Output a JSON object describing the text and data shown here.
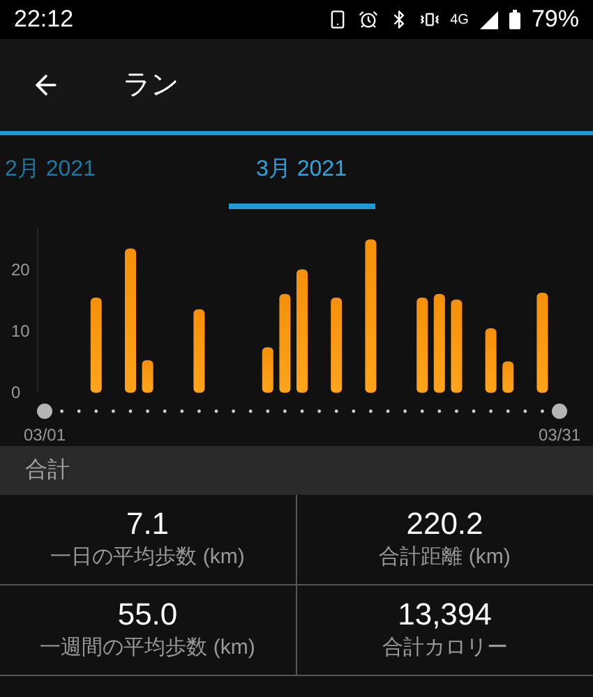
{
  "status_bar": {
    "time": "22:12",
    "network": "4G",
    "battery": "79%"
  },
  "header": {
    "title": "ラン"
  },
  "tabs": [
    {
      "label": "2月 2021",
      "selected": false
    },
    {
      "label": "3月 2021",
      "selected": true
    }
  ],
  "chart_data": {
    "type": "bar",
    "categories": [
      "03/01",
      null,
      null,
      null,
      null,
      null,
      null,
      null,
      null,
      null,
      null,
      null,
      null,
      null,
      null,
      null,
      null,
      null,
      null,
      null,
      null,
      null,
      null,
      null,
      null,
      null,
      null,
      null,
      null,
      null,
      "03/31"
    ],
    "series": [
      {
        "color": "#f5900a",
        "values": [
          null,
          null,
          null,
          15.5,
          null,
          23.5,
          5.3,
          null,
          null,
          13.6,
          null,
          null,
          null,
          7.4,
          16.1,
          20.1,
          null,
          15.5,
          null,
          25.0,
          null,
          null,
          15.5,
          16.1,
          15.2,
          null,
          10.5,
          5.1,
          null,
          16.3,
          null
        ]
      }
    ],
    "ylim": [
      0,
      27
    ],
    "yticks": [
      0,
      10,
      20
    ]
  },
  "summary": {
    "title": "合計",
    "stats": [
      {
        "value": "7.1",
        "label": "一日の平均歩数 (km)"
      },
      {
        "value": "220.2",
        "label": "合計距離 (km)"
      },
      {
        "value": "55.0",
        "label": "一週間の平均歩数 (km)"
      },
      {
        "value": "13,394",
        "label": "合計カロリー"
      }
    ]
  }
}
